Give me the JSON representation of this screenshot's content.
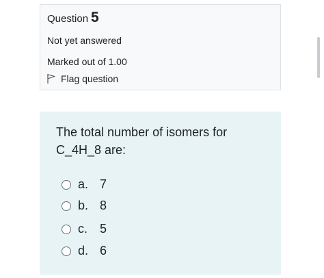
{
  "info": {
    "question_label": "Question",
    "question_number": "5",
    "state": "Not yet answered",
    "grade": "Marked out of 1.00",
    "flag_label": "Flag question"
  },
  "question": {
    "text": "The total number of isomers for C_4H_8 are:",
    "answers": [
      {
        "letter": "a.",
        "value": "7"
      },
      {
        "letter": "b.",
        "value": "8"
      },
      {
        "letter": "c.",
        "value": "5"
      },
      {
        "letter": "d.",
        "value": "6"
      }
    ]
  }
}
